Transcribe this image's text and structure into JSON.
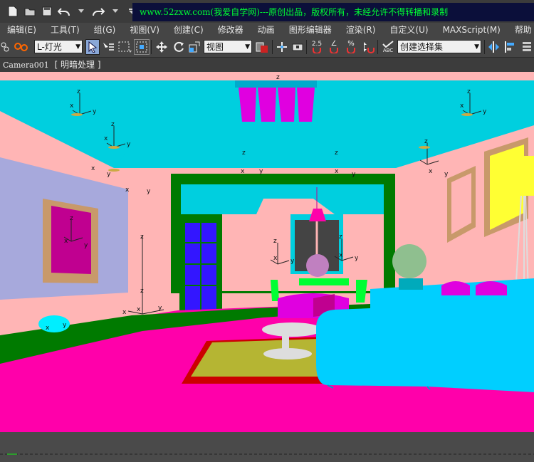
{
  "banner": {
    "text": "www.52zxw.com(我爱自学网)---原创出品，版权所有，未经允许不得转播和录制"
  },
  "menu": [
    {
      "label": "编辑(E)"
    },
    {
      "label": "工具(T)"
    },
    {
      "label": "组(G)"
    },
    {
      "label": "视图(V)"
    },
    {
      "label": "创建(C)"
    },
    {
      "label": "修改器"
    },
    {
      "label": "动画"
    },
    {
      "label": "图形编辑器"
    },
    {
      "label": "渲染(R)"
    },
    {
      "label": "自定义(U)"
    },
    {
      "label": "MAXScript(M)"
    },
    {
      "label": "帮助"
    }
  ],
  "toolbar": {
    "layer_select": "L-灯光",
    "coord_select": "视图",
    "snap_angle": "2.5",
    "percent_snap": "%",
    "named_selection": "创建选择集",
    "abc_label": "ABC"
  },
  "viewport": {
    "camera_label": "Camera001",
    "mode_label": "[ 明暗处理 ]"
  },
  "axes": {
    "x": "x",
    "y": "y",
    "z": "z"
  },
  "colors": {
    "wall": "#ffb5b5",
    "ceiling": "#00cfdf",
    "floor": "#ff00aa",
    "trim": "#007a00",
    "sofa": "#00cfff",
    "art": "#c00090",
    "door": "#3316ff"
  }
}
